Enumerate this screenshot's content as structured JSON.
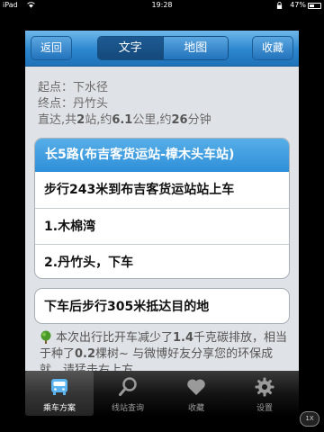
{
  "status_bar": {
    "carrier": "iPad",
    "time": "19:28",
    "battery": "47%"
  },
  "nav": {
    "back_label": "返回",
    "segments": [
      "文字",
      "地图"
    ],
    "selected_segment": "文字",
    "favorite_label": "收藏"
  },
  "summary": {
    "start": "起点：下水径",
    "end": "终点：丹竹头",
    "overview_prefix": "直达,共",
    "stops": "2",
    "overview_mid1": "站,约",
    "distance_km": "6.1",
    "overview_mid2": "公里,约",
    "minutes": "26",
    "overview_suffix": "分钟"
  },
  "route": {
    "header": "长5路(布吉客货运站-樟木头车站)",
    "walk_to_board": {
      "prefix": "步行",
      "meters": "243",
      "suffix": "米到布吉客货运站站上车"
    },
    "stops": [
      {
        "num": "1",
        "text": ".木棉湾"
      },
      {
        "num": "2",
        "text": ".丹竹头，下车"
      }
    ]
  },
  "final_walk": {
    "prefix": "下车后步行",
    "meters": "305",
    "suffix": "米抵达目的地"
  },
  "eco_note": {
    "p1": "本次出行比开车减少了",
    "kg": "1.4",
    "p2": "千克碳排放，相当于种了",
    "trees": "0.2",
    "p3": "棵树~ 与微博好友分享您的环保成就，请猛击右上方"
  },
  "tabs": [
    {
      "label": "乘车方案",
      "icon": "bus-icon",
      "active": true
    },
    {
      "label": "线站查询",
      "icon": "magnifier-icon",
      "active": false
    },
    {
      "label": "收藏",
      "icon": "heart-icon",
      "active": false
    },
    {
      "label": "设置",
      "icon": "gear-icon",
      "active": false
    }
  ],
  "zoom_label": "1X",
  "colors": {
    "nav_blue": "#2c86cf",
    "route_header": "#3a9ae0",
    "tabbar": "#141414"
  }
}
